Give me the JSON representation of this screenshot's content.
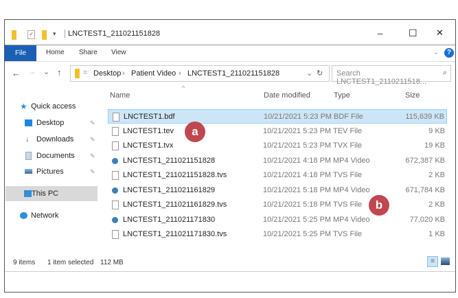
{
  "window": {
    "title": "LNCTEST1_211021151828",
    "minimize": "–",
    "maximize": "☐",
    "close": "✕"
  },
  "ribbon": {
    "tabs": [
      "File",
      "Home",
      "Share",
      "View"
    ],
    "help": "?"
  },
  "nav": {
    "back": "←",
    "forward": "→",
    "recent": "⌄",
    "up": "↑",
    "breadcrumb": [
      "Desktop",
      "Patient Video",
      "LNCTEST1_211021151828"
    ],
    "separator": "›",
    "refresh": "↻",
    "dropdown": "⌄",
    "search_placeholder": "Search LNCTEST1_2110211518...",
    "search_icon": "⌕"
  },
  "sidebar": {
    "items": [
      {
        "label": "Quick access",
        "icon": "star-icon",
        "color": "#2f8fd8"
      },
      {
        "label": "Desktop",
        "icon": "desktop-icon",
        "pinned": true,
        "color": "#1e88e5"
      },
      {
        "label": "Downloads",
        "icon": "download-icon",
        "pinned": true,
        "color": "#1e6fd0"
      },
      {
        "label": "Documents",
        "icon": "document-icon",
        "pinned": true,
        "color": "#9ab"
      },
      {
        "label": "Pictures",
        "icon": "pictures-icon",
        "pinned": true,
        "color": "#5a8fc0"
      },
      {
        "label": "This PC",
        "icon": "computer-icon",
        "selected": true,
        "color": "#2f8fd8"
      },
      {
        "label": "Network",
        "icon": "network-icon",
        "color": "#2f8fd8"
      }
    ]
  },
  "columns": {
    "name": "Name",
    "date": "Date modified",
    "type": "Type",
    "size": "Size"
  },
  "files": [
    {
      "name": "LNCTEST1.bdf",
      "date": "10/21/2021 5:23 PM",
      "type": "BDF File",
      "size": "115,639 KB",
      "kind": "file",
      "selected": true
    },
    {
      "name": "LNCTEST1.tev",
      "date": "10/21/2021 5:23 PM",
      "type": "TEV File",
      "size": "9 KB",
      "kind": "file"
    },
    {
      "name": "LNCTEST1.tvx",
      "date": "10/21/2021 5:23 PM",
      "type": "TVX File",
      "size": "19 KB",
      "kind": "file"
    },
    {
      "name": "LNCTEST1_211021151828",
      "date": "10/21/2021 4:18 PM",
      "type": "MP4 Video",
      "size": "672,387 KB",
      "kind": "video"
    },
    {
      "name": "LNCTEST1_211021151828.tvs",
      "date": "10/21/2021 4:18 PM",
      "type": "TVS File",
      "size": "2 KB",
      "kind": "file"
    },
    {
      "name": "LNCTEST1_211021161829",
      "date": "10/21/2021 5:18 PM",
      "type": "MP4 Video",
      "size": "671,784 KB",
      "kind": "video"
    },
    {
      "name": "LNCTEST1_211021161829.tvs",
      "date": "10/21/2021 5:18 PM",
      "type": "TVS File",
      "size": "2 KB",
      "kind": "file"
    },
    {
      "name": "LNCTEST1_211021171830",
      "date": "10/21/2021 5:25 PM",
      "type": "MP4 Video",
      "size": "77,020 KB",
      "kind": "video"
    },
    {
      "name": "LNCTEST1_211021171830.tvs",
      "date": "10/21/2021 5:25 PM",
      "type": "TVS File",
      "size": "1 KB",
      "kind": "file"
    }
  ],
  "status": {
    "count": "9 items",
    "selected": "1 item selected",
    "size": "112 MB"
  },
  "annotations": {
    "a": "a",
    "b": "b"
  },
  "colors": {
    "accent": "#1a5fb4",
    "selection": "#cde6f7",
    "badge": "#c0474f"
  }
}
